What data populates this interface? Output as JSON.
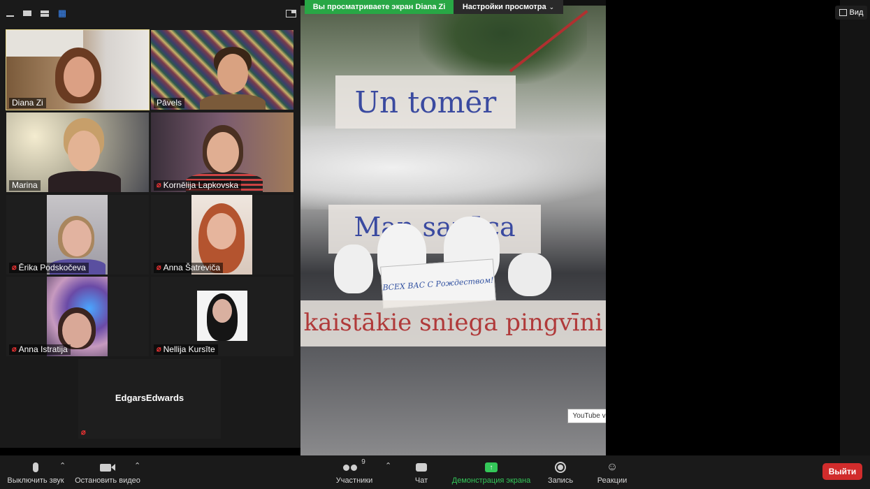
{
  "viewing_banner": {
    "text": "Вы просматриваете экран Diana Zi",
    "settings_label": "Настройки просмотра"
  },
  "view_button": {
    "label": "Вид"
  },
  "participants_tiles": [
    {
      "name": "Diana Zi",
      "muted": false,
      "active": true
    },
    {
      "name": "Pāvels",
      "muted": false
    },
    {
      "name": "Marina",
      "muted": false
    },
    {
      "name": "Kornēlija Lapkovska",
      "muted": true
    },
    {
      "name": "Ērika Podskočeva",
      "muted": true
    },
    {
      "name": "Anna Šatreviča",
      "muted": true
    },
    {
      "name": "Anna Istratija",
      "muted": true
    },
    {
      "name": "Nellija Kursīte",
      "muted": true
    },
    {
      "name": "EdgarsEdwards",
      "muted": true
    }
  ],
  "shared_content": {
    "sign_1": "Un tomēr",
    "sign_2": "Man sanāca",
    "sign_3": "kaistākie sniega pingvīni",
    "card_note": "ВСЕХ ВАС С Рождеством!",
    "tooltip": "YouTube video player"
  },
  "toolbar": {
    "mute_label": "Выключить звук",
    "video_label": "Остановить видео",
    "participants_label": "Участники",
    "participants_count": "9",
    "chat_label": "Чат",
    "share_label": "Демонстрация экрана",
    "record_label": "Запись",
    "reactions_label": "Реакции",
    "leave_label": "Выйти"
  },
  "colors": {
    "banner_green": "#28a745",
    "share_green": "#34c759",
    "leave_red": "#d12c2c",
    "active_speaker": "#e7d78a",
    "muted_red": "#e33333"
  }
}
